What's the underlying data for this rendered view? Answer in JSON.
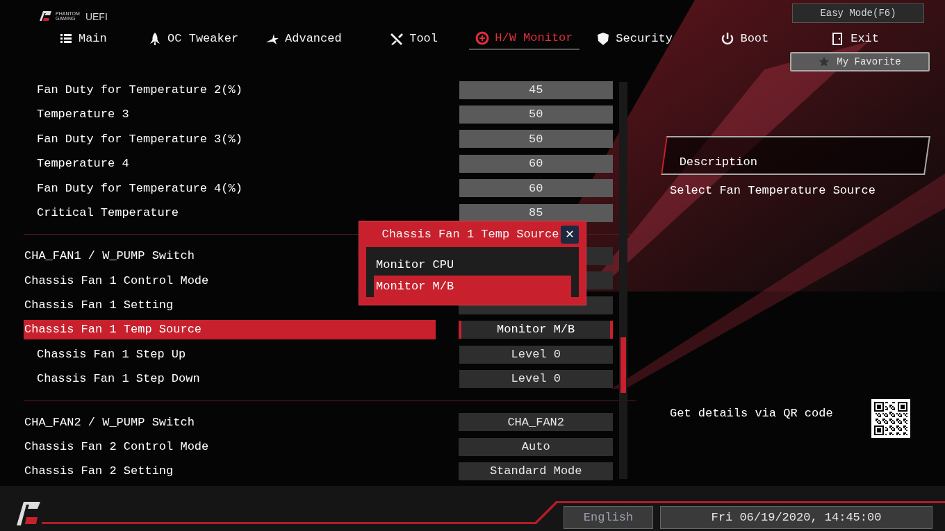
{
  "logo": {
    "brand_top": "PHANTOM",
    "brand_bottom": "GAMING",
    "product": "UEFI"
  },
  "easy_mode_button": "Easy Mode(F6)",
  "tabs": [
    {
      "label": "Main",
      "selected": false
    },
    {
      "label": "OC Tweaker",
      "selected": false
    },
    {
      "label": "Advanced",
      "selected": false
    },
    {
      "label": "Tool",
      "selected": false
    },
    {
      "label": "H/W Monitor",
      "selected": true
    },
    {
      "label": "Security",
      "selected": false
    },
    {
      "label": "Boot",
      "selected": false
    },
    {
      "label": "Exit",
      "selected": false
    }
  ],
  "my_favorite_button": "My Favorite",
  "settings": {
    "groups": [
      {
        "children": [
          {
            "label": "Fan Duty for Temperature 2(%)",
            "value": "45",
            "selected": false
          },
          {
            "label": "Temperature 3",
            "value": "50",
            "selected": false
          },
          {
            "label": "Fan Duty for Temperature 3(%)",
            "value": "50",
            "selected": false
          },
          {
            "label": "Temperature 4",
            "value": "60",
            "selected": false
          },
          {
            "label": "Fan Duty for Temperature 4(%)",
            "value": "60",
            "selected": false
          },
          {
            "label": "Critical Temperature",
            "value": "85",
            "selected": false
          }
        ]
      },
      {
        "rows": [
          {
            "label": "CHA_FAN1 / W_PUMP Switch",
            "selected": false
          },
          {
            "label": "Chassis Fan 1 Control Mode",
            "selected": false
          },
          {
            "label": "Chassis Fan 1 Setting",
            "selected": false
          },
          {
            "label": "Chassis Fan 1 Temp Source",
            "value": "Monitor M/B",
            "selected": true,
            "children": [
              {
                "label": "Chassis Fan 1 Step Up",
                "value": "Level 0",
                "selected": false
              },
              {
                "label": "Chassis Fan 1 Step Down",
                "value": "Level 0",
                "selected": false
              }
            ]
          }
        ]
      },
      {
        "rows": [
          {
            "label": "CHA_FAN2 / W_PUMP Switch",
            "value": "CHA_FAN2",
            "selected": false
          },
          {
            "label": "Chassis Fan 2 Control Mode",
            "value": "Auto",
            "selected": false
          },
          {
            "label": "Chassis Fan 2 Setting",
            "value": "Standard Mode",
            "selected": false
          }
        ]
      }
    ]
  },
  "popup": {
    "title": "Chassis Fan 1 Temp Source",
    "close": "✕",
    "options": [
      {
        "label": "Monitor CPU",
        "selected": false
      },
      {
        "label": "Monitor M/B",
        "selected": true
      }
    ]
  },
  "description": {
    "title": "Description",
    "text": "Select Fan Temperature Source"
  },
  "qr_hint": "Get details via QR code",
  "status_bar": {
    "language": "English",
    "datetime": "Fri 06/19/2020, 14:45:00"
  }
}
